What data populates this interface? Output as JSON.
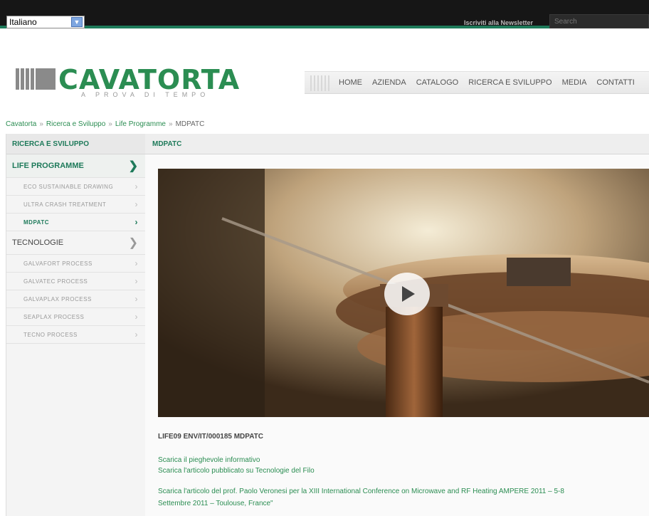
{
  "topbar": {
    "language": "Italiano",
    "newsletter": "Iscriviti alla Newsletter",
    "search_placeholder": "Search"
  },
  "logo": {
    "name": "CAVATORTA",
    "tagline": "A PROVA DI TEMPO"
  },
  "nav": [
    "HOME",
    "AZIENDA",
    "CATALOGO",
    "RICERCA E SVILUPPO",
    "MEDIA",
    "CONTATTI"
  ],
  "breadcrumb": [
    "Cavatorta",
    "Ricerca e Sviluppo",
    "Life Programme",
    "MDPATC"
  ],
  "sidebar": {
    "header": "RICERCA E SVILUPPO",
    "life": "LIFE PROGRAMME",
    "life_items": [
      "ECO SUSTAINABLE DRAWING",
      "ULTRA CRASH TREATMENT",
      "MDPATC"
    ],
    "tech": "TECNOLOGIE",
    "tech_items": [
      "GALVAFORT PROCESS",
      "GALVATEC PROCESS",
      "GALVAPLAX PROCESS",
      "SEAPLAX PROCESS",
      "TECNO PROCESS"
    ]
  },
  "content": {
    "header": "MDPATC",
    "doc_title": "LIFE09 ENV/IT/000185 MDPATC",
    "links": [
      "Scarica il pieghevole informativo",
      "Scarica l'articolo pubblicato su Tecnologie del Filo",
      "Scarica l'articolo del prof. Paolo Veronesi per la XIII International Conference on Microwave and RF Heating AMPERE 2011 – 5-8",
      "Settembre 2011 – Toulouse, France\""
    ]
  },
  "colors": {
    "brand_green": "#2b8d52",
    "topbar": "#161616",
    "accent_line": "#1e7a5a"
  }
}
